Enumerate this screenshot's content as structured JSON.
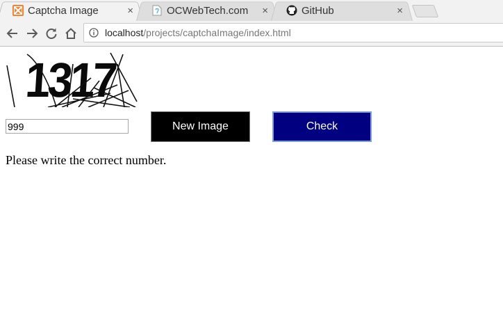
{
  "browser": {
    "tabs": [
      {
        "title": "Captcha Image",
        "favicon": "xampp-icon",
        "active": true,
        "close": "×"
      },
      {
        "title": "OCWebTech.com",
        "favicon": "page-icon",
        "active": false,
        "close": "×"
      },
      {
        "title": "GitHub",
        "favicon": "github-icon",
        "active": false,
        "close": "×"
      }
    ],
    "address": {
      "host": "localhost",
      "path": "/projects/captchaImage/index.html"
    }
  },
  "page": {
    "captcha": {
      "text": "1317"
    },
    "answer_input": {
      "value": "999"
    },
    "new_image_button": "New Image",
    "check_button": "Check",
    "message": "Please write the correct number."
  },
  "colors": {
    "new_image_button_bg": "#000000",
    "check_button_bg": "#000080",
    "xampp_orange": "#fb7a24"
  }
}
